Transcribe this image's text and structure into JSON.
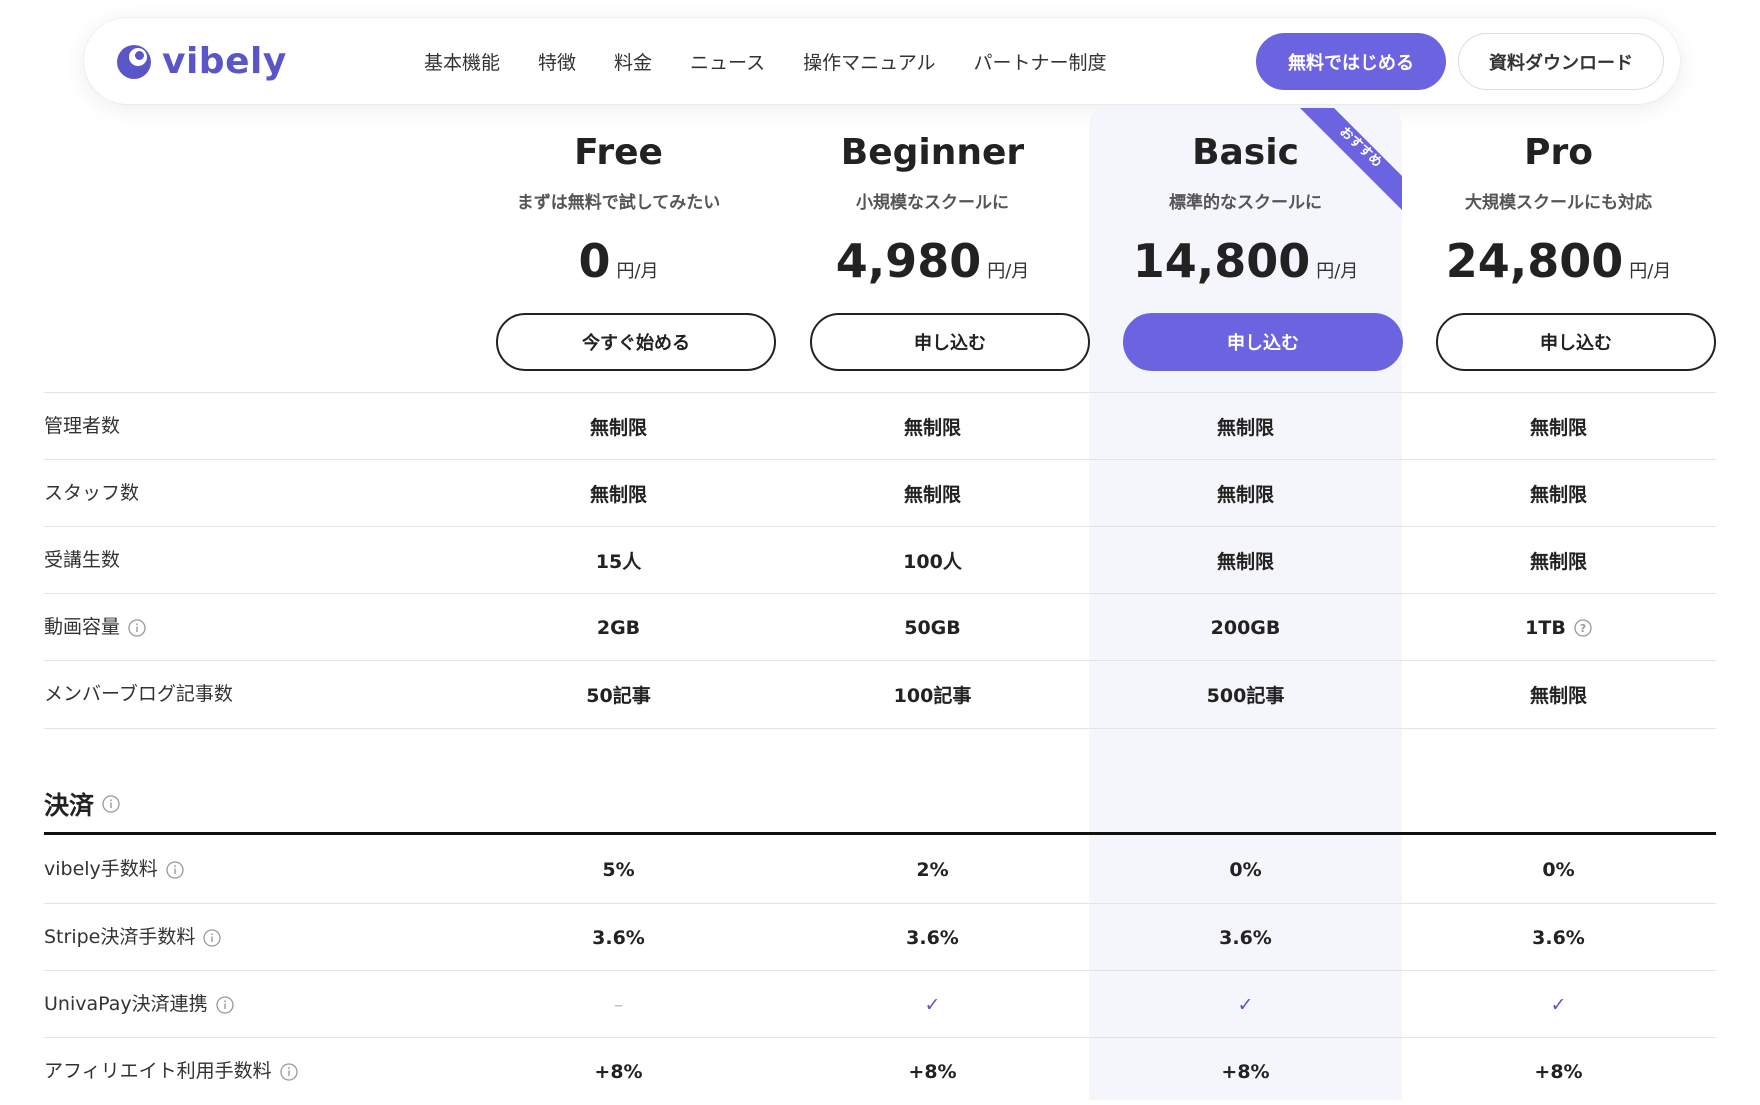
{
  "header": {
    "logo_text": "vibely",
    "nav": [
      "基本機能",
      "特徴",
      "料金",
      "ニュース",
      "操作マニュアル",
      "パートナー制度"
    ],
    "cta_primary": "無料ではじめる",
    "cta_secondary": "資料ダウンロード"
  },
  "ribbon": "おすすめ",
  "plans": [
    {
      "name": "Free",
      "tagline": "まずは無料で試してみたい",
      "price": "0",
      "unit": "円/月",
      "button": "今すぐ始める"
    },
    {
      "name": "Beginner",
      "tagline": "小規模なスクールに",
      "price": "4,980",
      "unit": "円/月",
      "button": "申し込む"
    },
    {
      "name": "Basic",
      "tagline": "標準的なスクールに",
      "price": "14,800",
      "unit": "円/月",
      "button": "申し込む"
    },
    {
      "name": "Pro",
      "tagline": "大規模スクールにも対応",
      "price": "24,800",
      "unit": "円/月",
      "button": "申し込む"
    }
  ],
  "rows": [
    {
      "label": "管理者数",
      "values": [
        "無制限",
        "無制限",
        "無制限",
        "無制限"
      ]
    },
    {
      "label": "スタッフ数",
      "values": [
        "無制限",
        "無制限",
        "無制限",
        "無制限"
      ]
    },
    {
      "label": "受講生数",
      "values": [
        "15人",
        "100人",
        "無制限",
        "無制限"
      ]
    },
    {
      "label": "動画容量",
      "values": [
        "2GB",
        "50GB",
        "200GB",
        "1TB"
      ]
    },
    {
      "label": "メンバーブログ記事数",
      "values": [
        "50記事",
        "100記事",
        "500記事",
        "無制限"
      ]
    }
  ],
  "payment": {
    "title": "決済",
    "rows": [
      {
        "label": "vibely手数料",
        "values": [
          "5%",
          "2%",
          "0%",
          "0%"
        ]
      },
      {
        "label": "Stripe決済手数料",
        "values": [
          "3.6%",
          "3.6%",
          "3.6%",
          "3.6%"
        ]
      },
      {
        "label": "UnivaPay決済連携",
        "values": [
          "–",
          "✓",
          "✓",
          "✓"
        ]
      },
      {
        "label": "アフィリエイト利用手数料",
        "values": [
          "+8%",
          "+8%",
          "+8%",
          "+8%"
        ]
      }
    ]
  },
  "colors": {
    "accent": "#6c63e0",
    "highlight_bg": "#f5f6fb",
    "check": "#5b56c7"
  }
}
